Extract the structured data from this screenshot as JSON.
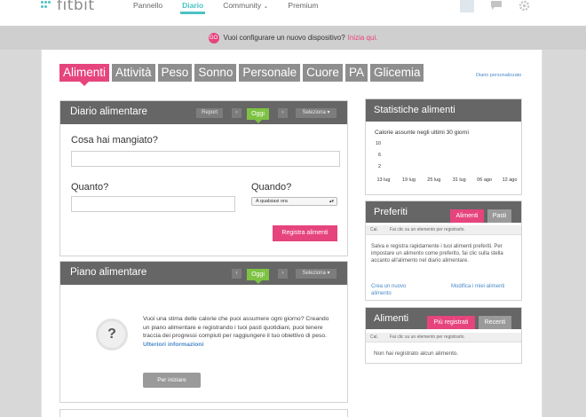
{
  "nav": {
    "brand": "fitbit",
    "links": [
      "Pannello",
      "Diario",
      "Community",
      "Premium"
    ],
    "community_caret": "⌄"
  },
  "banner": {
    "icon_text": "GO",
    "text": "Vuoi configurare un nuovo dispositivo?",
    "link": "Inizia qui."
  },
  "tabs": [
    "Alimenti",
    "Attività",
    "Peso",
    "Sonno",
    "Personale",
    "Cuore",
    "PA",
    "Glicemia"
  ],
  "custom_diary_link": "Diario personalizzato",
  "food_diary": {
    "title": "Diario alimentare",
    "report": "Report",
    "prev": "‹",
    "today": "Oggi",
    "next": "›",
    "select": "Seleziona",
    "what_label": "Cosa hai mangiato?",
    "qty_label": "Quanto?",
    "when_label": "Quando?",
    "when_value": "A qualsiasi ora",
    "log_button": "Registra alimenti"
  },
  "meal_plan": {
    "title": "Piano alimentare",
    "prev": "‹",
    "today": "Oggi",
    "next": "›",
    "select": "Seleziona",
    "question_mark": "?",
    "text": "Vuoi una stima delle calorie che puoi assumere ogni giorno? Creando un piano alimentare e registrando i tuoi pasti quotidiani, puoi tenere traccia dei progressi compiuti per raggiungere il tuo obiettivo di peso.",
    "more_link": "Ulteriori informazioni",
    "start_button": "Per iniziare"
  },
  "stats": {
    "title": "Statistiche alimenti",
    "subtitle": "Calorie assunte negli ultimi 30 giorni"
  },
  "chart_data": {
    "type": "line",
    "title": "Calorie assunte negli ultimi 30 giorni",
    "xlabel": "",
    "ylabel": "",
    "y_ticks": [
      "10",
      "6",
      "2"
    ],
    "x_ticks": [
      "13 lug",
      "19 lug",
      "25 lug",
      "31 lug",
      "06 ago",
      "12 ago"
    ],
    "series": [],
    "ylim": [
      0,
      10
    ],
    "grid": false
  },
  "favorites": {
    "title": "Preferiti",
    "tab_active": "Alimenti",
    "tab_other": "Pasti",
    "col1": "Cal.",
    "col2": "Fai clic su un elemento per registrarlo.",
    "text": "Salva e registra rapidamente i tuoi alimenti preferiti. Per impostare un alimento come preferito, fai clic sulla stella accanto all'alimento nel diario alimentare.",
    "link_create": "Crea un nuovo alimento",
    "link_edit": "Modifica i miei alimenti"
  },
  "foods": {
    "title": "Alimenti",
    "tab_active": "Più registrati",
    "tab_other": "Recenti",
    "col1": "Cal.",
    "col2": "Fai clic su un elemento per registrarlo.",
    "empty": "Non hai registrato alcun alimento."
  },
  "colors": {
    "accent_pink": "#e6447d",
    "accent_green": "#7dc242",
    "brand_teal": "#4cc2c4",
    "header_gray": "#666666"
  }
}
